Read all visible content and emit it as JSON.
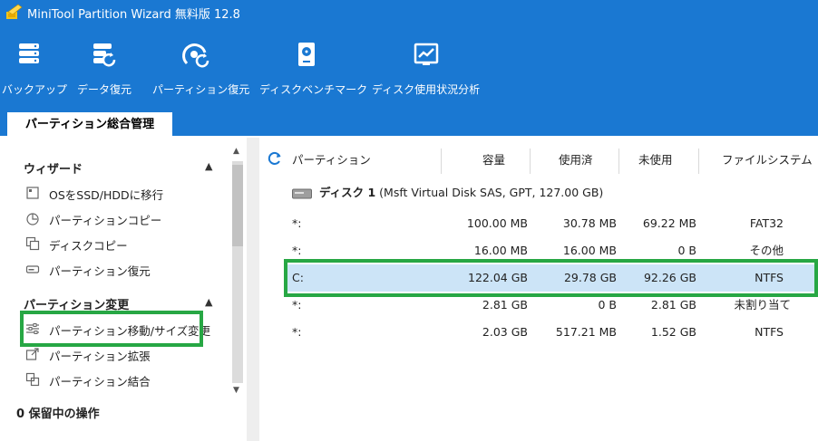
{
  "app": {
    "title": "MiniTool Partition Wizard 無料版 12.8"
  },
  "toolbar": [
    {
      "label": "バックアップ",
      "icon": "backup-icon"
    },
    {
      "label": "データ復元",
      "icon": "data-recovery-icon"
    },
    {
      "label": "パーティション復元",
      "icon": "partition-recovery-icon"
    },
    {
      "label": "ディスクベンチマーク",
      "icon": "disk-benchmark-icon"
    },
    {
      "label": "ディスク使用状況分析",
      "icon": "space-analyzer-icon"
    }
  ],
  "tab": {
    "label": "パーティション総合管理"
  },
  "sidebar": {
    "wizard": {
      "title": "ウィザード",
      "items": [
        {
          "label": "OSをSSD/HDDに移行",
          "icon": "migrate-os-icon"
        },
        {
          "label": "パーティションコピー",
          "icon": "copy-partition-icon"
        },
        {
          "label": "ディスクコピー",
          "icon": "copy-disk-icon"
        },
        {
          "label": "パーティション復元",
          "icon": "partition-recovery-icon"
        }
      ]
    },
    "change": {
      "title": "パーティション変更",
      "items": [
        {
          "label": "パーティション移動/サイズ変更",
          "icon": "move-resize-icon"
        },
        {
          "label": "パーティション拡張",
          "icon": "extend-partition-icon"
        },
        {
          "label": "パーティション結合",
          "icon": "merge-partition-icon"
        }
      ]
    },
    "pending": "0 保留中の操作"
  },
  "table": {
    "headers": {
      "partition": "パーティション",
      "capacity": "容量",
      "used": "使用済",
      "unused": "未使用",
      "filesystem": "ファイルシステム"
    },
    "disk": {
      "name": "ディスク 1",
      "detail": "(Msft Virtual Disk SAS, GPT, 127.00 GB)"
    },
    "rows": [
      {
        "partition": "*:",
        "capacity": "100.00 MB",
        "used": "30.78 MB",
        "unused": "69.22 MB",
        "filesystem": "FAT32"
      },
      {
        "partition": "*:",
        "capacity": "16.00 MB",
        "used": "16.00 MB",
        "unused": "0 B",
        "filesystem": "その他"
      },
      {
        "partition": "C:",
        "capacity": "122.04 GB",
        "used": "29.78 GB",
        "unused": "92.26 GB",
        "filesystem": "NTFS"
      },
      {
        "partition": "*:",
        "capacity": "2.81 GB",
        "used": "0 B",
        "unused": "2.81 GB",
        "filesystem": "未割り当て"
      },
      {
        "partition": "*:",
        "capacity": "2.03 GB",
        "used": "517.21 MB",
        "unused": "1.52 GB",
        "filesystem": "NTFS"
      }
    ]
  },
  "colors": {
    "ribbon": "#1a78d2",
    "selected_row": "#cce4f7",
    "highlight": "#27a744"
  }
}
